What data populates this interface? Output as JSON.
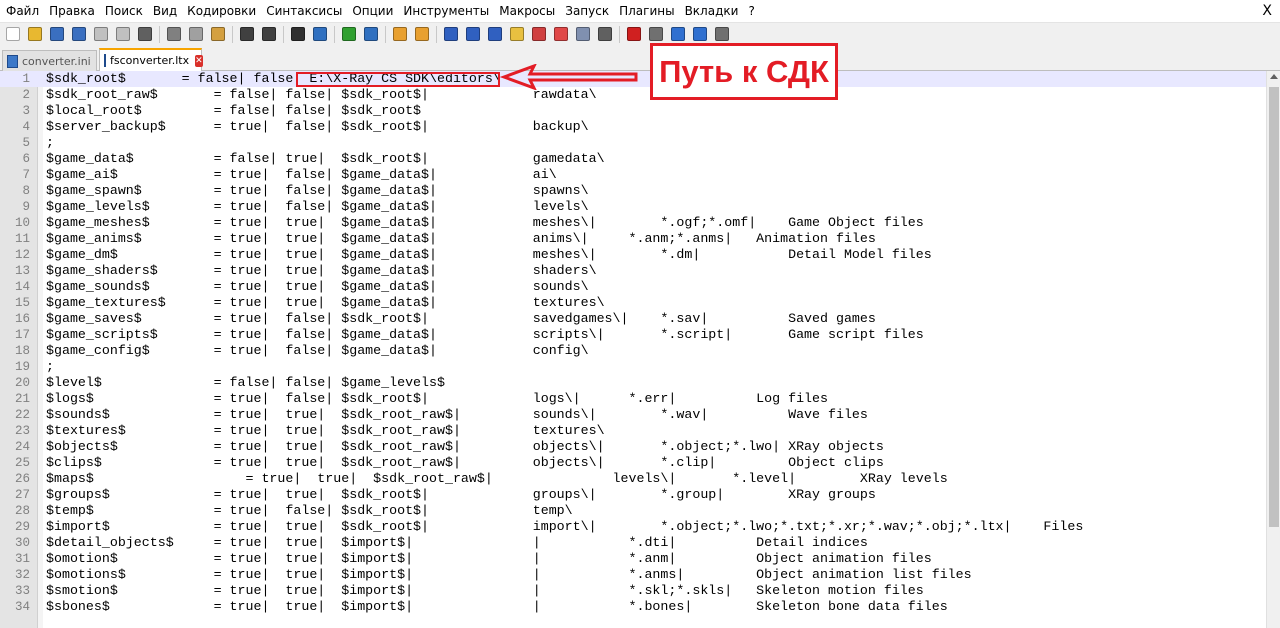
{
  "menubar": {
    "items": [
      "Файл",
      "Правка",
      "Поиск",
      "Вид",
      "Кодировки",
      "Синтаксисы",
      "Опции",
      "Инструменты",
      "Макросы",
      "Запуск",
      "Плагины",
      "Вкладки",
      "?"
    ],
    "close_glyph": "X"
  },
  "toolbar": {
    "buttons": [
      {
        "name": "new-file-icon",
        "color": "#ffffff"
      },
      {
        "name": "open-file-icon",
        "color": "#e8b830"
      },
      {
        "name": "save-icon",
        "color": "#3a6fc0"
      },
      {
        "name": "save-all-icon",
        "color": "#3a6fc0"
      },
      {
        "name": "close-icon",
        "color": "#c0c0c0"
      },
      {
        "name": "close-all-icon",
        "color": "#c0c0c0"
      },
      {
        "name": "print-icon",
        "color": "#606060"
      },
      {
        "sep": true
      },
      {
        "name": "cut-icon",
        "color": "#808080"
      },
      {
        "name": "copy-icon",
        "color": "#a0a0a0"
      },
      {
        "name": "paste-icon",
        "color": "#d4a040"
      },
      {
        "sep": true
      },
      {
        "name": "undo-icon",
        "color": "#404040"
      },
      {
        "name": "redo-icon",
        "color": "#404040"
      },
      {
        "sep": true
      },
      {
        "name": "find-icon",
        "color": "#303030"
      },
      {
        "name": "replace-icon",
        "color": "#3070c0"
      },
      {
        "sep": true
      },
      {
        "name": "zoom-in-icon",
        "color": "#30a030"
      },
      {
        "name": "zoom-out-icon",
        "color": "#3070c0"
      },
      {
        "sep": true
      },
      {
        "name": "sync-vertical-icon",
        "color": "#e8a030"
      },
      {
        "name": "sync-horizontal-icon",
        "color": "#e8a030"
      },
      {
        "sep": true
      },
      {
        "name": "word-wrap-icon",
        "color": "#3060c0"
      },
      {
        "name": "show-all-chars-icon",
        "color": "#3060c0"
      },
      {
        "name": "indent-guide-icon",
        "color": "#3060c0"
      },
      {
        "name": "language-icon",
        "color": "#e8c040"
      },
      {
        "name": "doc-map-icon",
        "color": "#d04040"
      },
      {
        "name": "function-list-icon",
        "color": "#e04848"
      },
      {
        "name": "folder-workspace-icon",
        "color": "#8090b0"
      },
      {
        "name": "monitoring-icon",
        "color": "#606060"
      },
      {
        "sep": true
      },
      {
        "name": "record-macro-icon",
        "color": "#d02020"
      },
      {
        "name": "stop-record-icon",
        "color": "#707070"
      },
      {
        "name": "playback-icon",
        "color": "#3070d0"
      },
      {
        "name": "run-macro-multiple-icon",
        "color": "#3070d0"
      },
      {
        "name": "save-macro-icon",
        "color": "#707070"
      }
    ]
  },
  "tabs": [
    {
      "label": "converter.ini",
      "active": false
    },
    {
      "label": "fsconverter.ltx",
      "active": true
    }
  ],
  "editor": {
    "current_line": 1,
    "lines": [
      "$sdk_root$       = false| false| E:\\X-Ray CS SDK\\editors\\",
      "$sdk_root_raw$       = false| false| $sdk_root$|             rawdata\\",
      "$local_root$         = false| false| $sdk_root$",
      "$server_backup$      = true|  false| $sdk_root$|             backup\\",
      ";",
      "$game_data$          = false| true|  $sdk_root$|             gamedata\\",
      "$game_ai$            = true|  false| $game_data$|            ai\\",
      "$game_spawn$         = true|  false| $game_data$|            spawns\\",
      "$game_levels$        = true|  false| $game_data$|            levels\\",
      "$game_meshes$        = true|  true|  $game_data$|            meshes\\|        *.ogf;*.omf|    Game Object files",
      "$game_anims$         = true|  true|  $game_data$|            anims\\|     *.anm;*.anms|   Animation files",
      "$game_dm$            = true|  true|  $game_data$|            meshes\\|        *.dm|           Detail Model files",
      "$game_shaders$       = true|  true|  $game_data$|            shaders\\",
      "$game_sounds$        = true|  true|  $game_data$|            sounds\\",
      "$game_textures$      = true|  true|  $game_data$|            textures\\",
      "$game_saves$         = true|  false| $sdk_root$|             savedgames\\|    *.sav|          Saved games",
      "$game_scripts$       = true|  false| $game_data$|            scripts\\|       *.script|       Game script files",
      "$game_config$        = true|  false| $game_data$|            config\\",
      ";",
      "$level$              = false| false| $game_levels$",
      "$logs$               = true|  false| $sdk_root$|             logs\\|      *.err|          Log files",
      "$sounds$             = true|  true|  $sdk_root_raw$|         sounds\\|        *.wav|          Wave files",
      "$textures$           = true|  true|  $sdk_root_raw$|         textures\\",
      "$objects$            = true|  true|  $sdk_root_raw$|         objects\\|       *.object;*.lwo| XRay objects",
      "$clips$              = true|  true|  $sdk_root_raw$|         objects\\|       *.clip|         Object clips",
      "$maps$                   = true|  true|  $sdk_root_raw$|               levels\\|       *.level|        XRay levels",
      "$groups$             = true|  true|  $sdk_root$|             groups\\|        *.group|        XRay groups",
      "$temp$               = true|  false| $sdk_root$|             temp\\",
      "$import$             = true|  true|  $sdk_root$|             import\\|        *.object;*.lwo;*.txt;*.xr;*.wav;*.obj;*.ltx|    Files",
      "$detail_objects$     = true|  true|  $import$|               |           *.dti|          Detail indices",
      "$omotion$            = true|  true|  $import$|               |           *.anm|          Object animation files",
      "$omotions$           = true|  true|  $import$|               |           *.anms|         Object animation list files",
      "$smotion$            = true|  true|  $import$|               |           *.skl;*.skls|   Skeleton motion files",
      "$sbones$             = true|  true|  $import$|               |           *.bones|        Skeleton bone data files"
    ]
  },
  "annotation": {
    "label": "Путь к СДК",
    "color": "#e31c25"
  }
}
